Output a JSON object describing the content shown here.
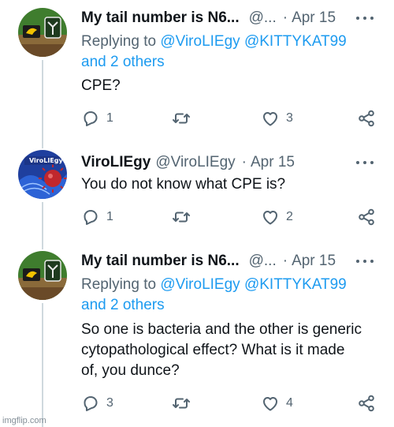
{
  "tweets": [
    {
      "display_name": "My tail number is N6...",
      "handle": "@...",
      "separator": "·",
      "date": "Apr 15",
      "reply_prefix": "Replying to",
      "reply_mentions": [
        "@ViroLIEgy",
        "@KITTYKAT99"
      ],
      "reply_others": "and 2 others",
      "text": "CPE?",
      "replies": "1",
      "retweets": "",
      "likes": "3"
    },
    {
      "display_name": "ViroLIEgy",
      "handle": "@ViroLIEgy",
      "separator": "·",
      "date": "Apr 15",
      "avatar_text": "ViroLIEgy",
      "text": "You do not know what CPE is?",
      "replies": "1",
      "retweets": "",
      "likes": "2"
    },
    {
      "display_name": "My tail number is N6...",
      "handle": "@...",
      "separator": "·",
      "date": "Apr 15",
      "reply_prefix": "Replying to",
      "reply_mentions": [
        "@ViroLIEgy",
        "@KITTYKAT99"
      ],
      "reply_others": "and 2 others",
      "text_lines": [
        "So one is bacteria and the other is generic",
        "cytopathological effect? What is it made",
        "of, you dunce?"
      ],
      "replies": "3",
      "retweets": "",
      "likes": "4"
    }
  ],
  "watermark": "imgflip.com",
  "colors": {
    "text": "#0f1419",
    "secondary": "#536471",
    "link": "#1d9bf0",
    "thread_line": "#cfd9de"
  },
  "icons": [
    "reply-icon",
    "retweet-icon",
    "like-icon",
    "share-icon",
    "more-icon"
  ]
}
